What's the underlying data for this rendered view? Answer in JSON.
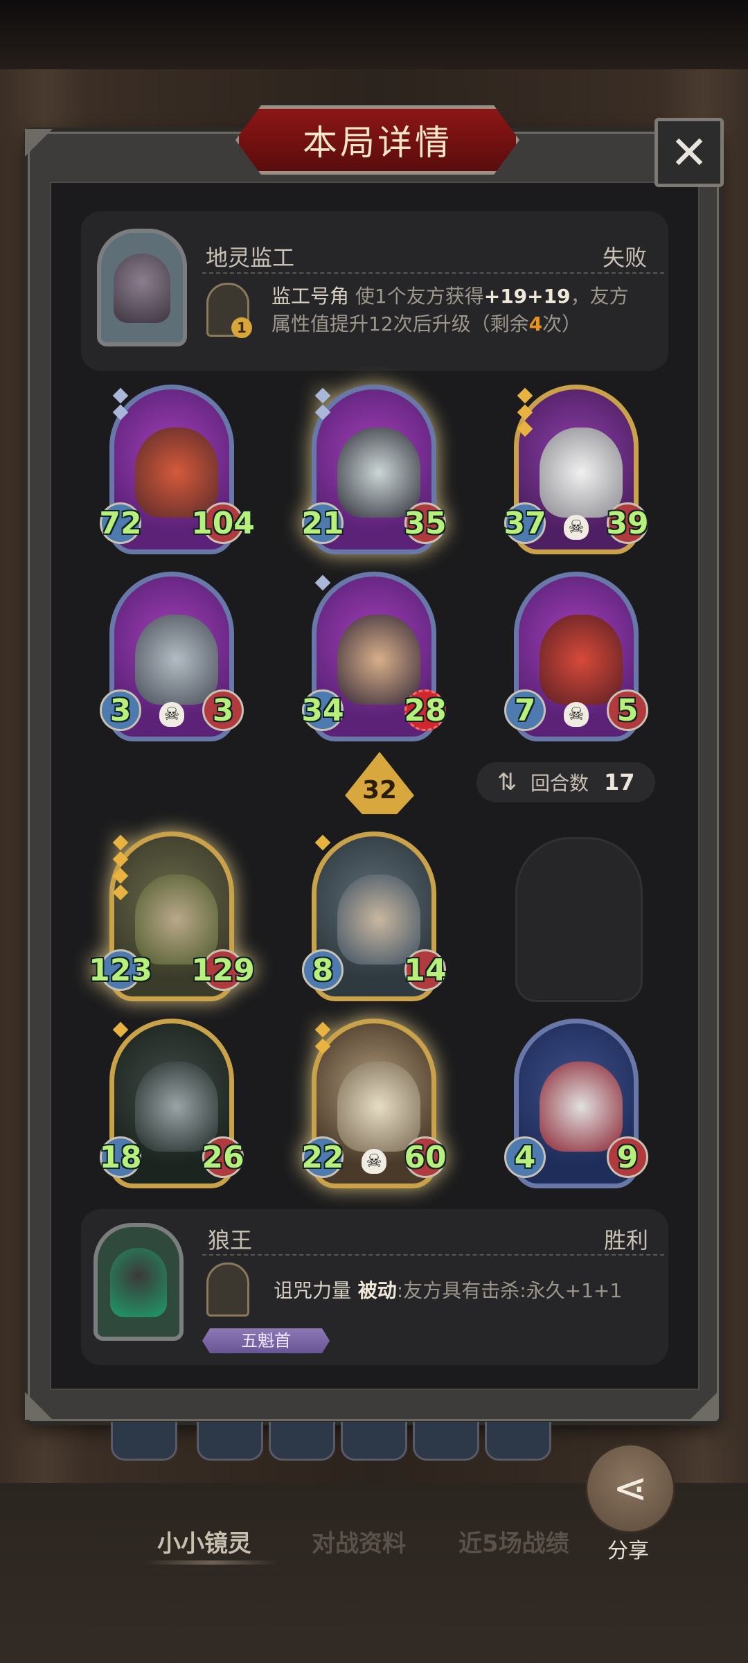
{
  "dialog": {
    "title": "本局详情",
    "close_icon": "✕"
  },
  "opponent": {
    "name": "地灵监工",
    "result": "失败",
    "skill": {
      "level": "1",
      "name": "监工号角",
      "desc_before": " 使1个友方获得",
      "buff": "+19+19",
      "desc_middle": "，友方属性值提升12次后升级（剩余",
      "remaining": "4",
      "desc_after": "次）"
    }
  },
  "opponent_board": [
    {
      "atk": "72",
      "hp": "104"
    },
    {
      "atk": "21",
      "hp": "35"
    },
    {
      "atk": "37",
      "hp": "39"
    },
    {
      "atk": "3",
      "hp": "3"
    },
    {
      "atk": "34",
      "hp": "28"
    },
    {
      "atk": "7",
      "hp": "5"
    }
  ],
  "tavern_level": "32",
  "rounds": {
    "label": "回合数",
    "value": "17"
  },
  "player_board": [
    {
      "atk": "123",
      "hp": "129"
    },
    {
      "atk": "8",
      "hp": "14"
    },
    {
      "atk": "18",
      "hp": "26"
    },
    {
      "atk": "22",
      "hp": "60"
    },
    {
      "atk": "4",
      "hp": "9"
    }
  ],
  "player": {
    "name": "狼王",
    "result": "胜利",
    "title_badge": "五魁首",
    "skill": {
      "name": "诅咒力量",
      "type": " 被动",
      "desc": ":友方具有击杀:永久+1+1"
    }
  },
  "tabs": [
    "小小镜灵",
    "对战资料",
    "近5场战绩"
  ],
  "share_label": "分享",
  "colors": {
    "accent_red": "#8d1616",
    "stat_green": "#b8f07c",
    "gold_frame": "#c9a24a"
  }
}
